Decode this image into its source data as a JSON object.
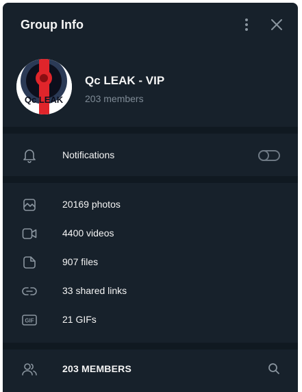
{
  "header": {
    "title": "Group Info"
  },
  "group": {
    "name": "Qc LEAK - VIP",
    "members_count": "203 members",
    "avatar_text": "Qc LEAK"
  },
  "notifications": {
    "label": "Notifications",
    "enabled": false
  },
  "media": [
    {
      "icon": "photo-icon",
      "label": "20169 photos"
    },
    {
      "icon": "video-icon",
      "label": "4400 videos"
    },
    {
      "icon": "file-icon",
      "label": "907 files"
    },
    {
      "icon": "link-icon",
      "label": "33 shared links"
    },
    {
      "icon": "gif-icon",
      "label": "21 GIFs"
    }
  ],
  "members": {
    "label": "203 MEMBERS"
  },
  "colors": {
    "panel": "#17212b",
    "divider": "#101921",
    "muted": "#7f8b96",
    "icon": "#8b96a0"
  }
}
